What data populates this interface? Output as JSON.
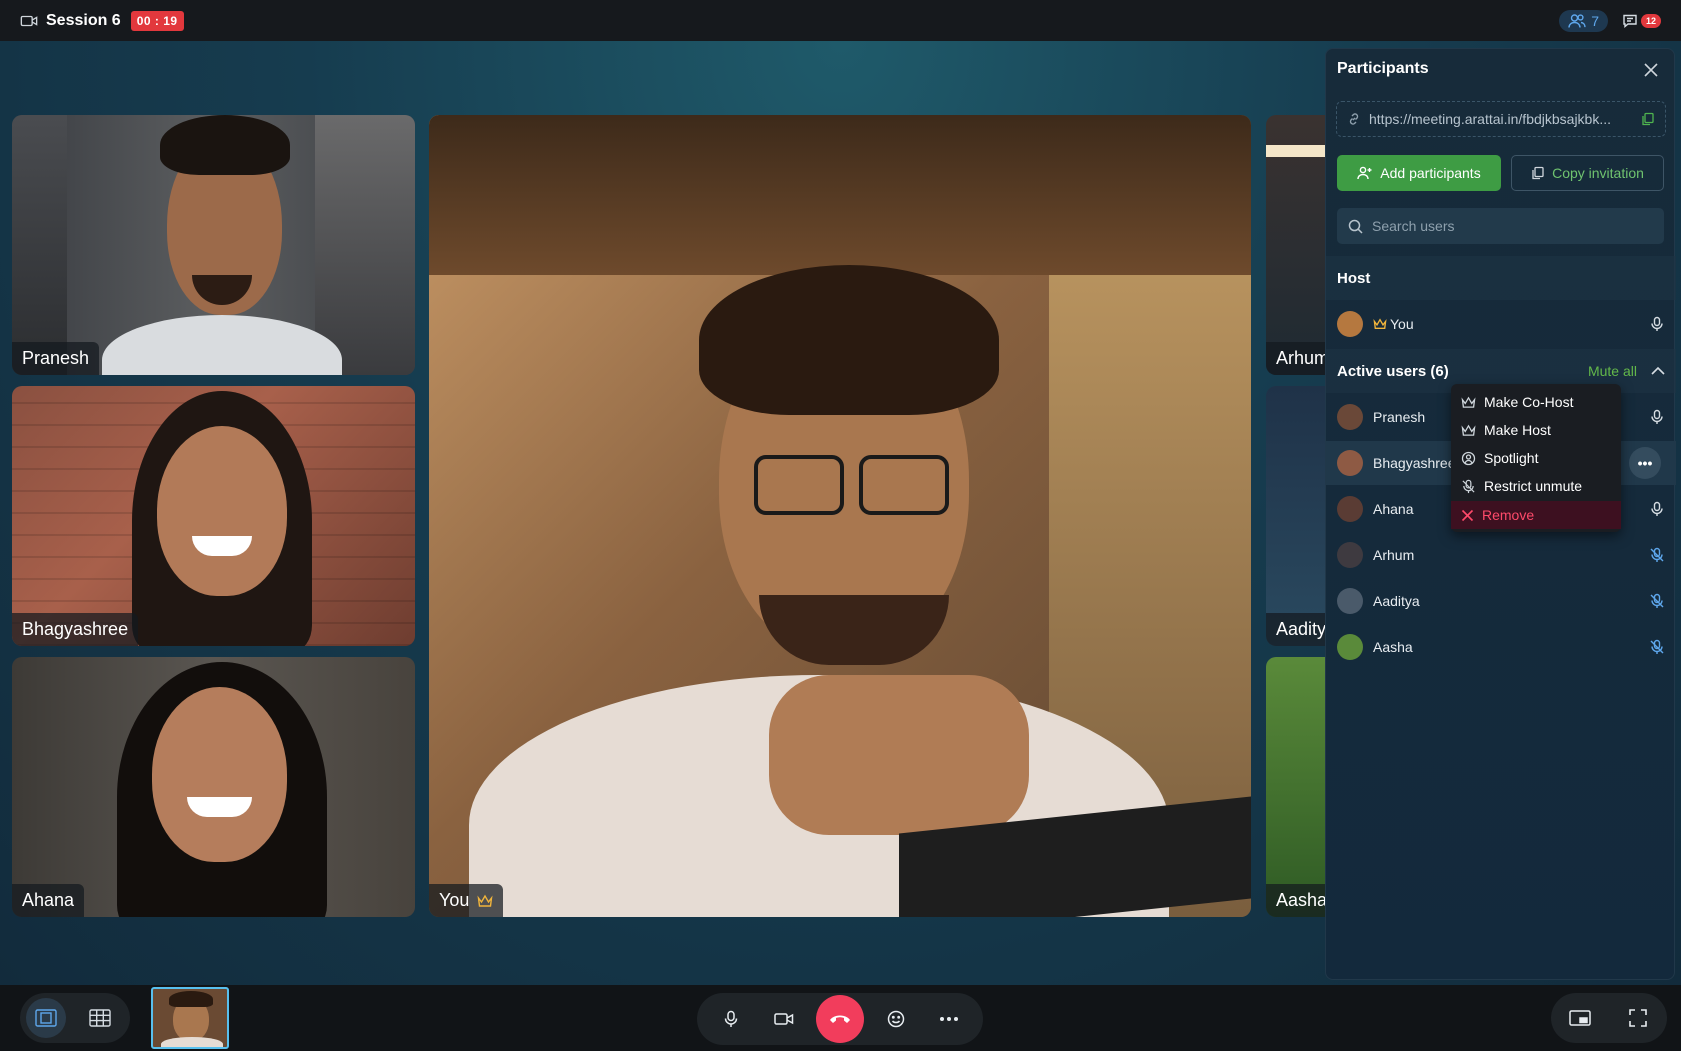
{
  "topbar": {
    "session_title": "Session 6",
    "timer": "00 : 19",
    "participant_count": "7",
    "chat_badge": "12"
  },
  "tiles": {
    "pranesh": "Pranesh",
    "bhagyashree": "Bhagyashree",
    "ahana": "Ahana",
    "you": "You",
    "arhum": "Arhum",
    "aaditya": "Aadity",
    "aasha": "Aasha"
  },
  "panel": {
    "title": "Participants",
    "invite_url": "https://meeting.arattai.in/fbdjkbsajkbk...",
    "add_button": "Add participants",
    "copy_button": "Copy invitation",
    "search_placeholder": "Search users",
    "host_section": "Host",
    "host_name": "You",
    "active_section": "Active users (6)",
    "mute_all": "Mute all",
    "users": [
      {
        "name": "Pranesh",
        "mic": "on"
      },
      {
        "name": "Bhagyashree",
        "mic": "menu"
      },
      {
        "name": "Ahana",
        "mic": "on"
      },
      {
        "name": "Arhum",
        "mic": "off"
      },
      {
        "name": "Aaditya",
        "mic": "off"
      },
      {
        "name": "Aasha",
        "mic": "off"
      }
    ]
  },
  "context_menu": {
    "items": [
      {
        "label": "Make Co-Host",
        "icon": "crown-icon"
      },
      {
        "label": "Make Host",
        "icon": "crown-icon"
      },
      {
        "label": "Spotlight",
        "icon": "spotlight-icon"
      },
      {
        "label": "Restrict unmute",
        "icon": "mic-off-icon"
      },
      {
        "label": "Remove",
        "icon": "close-icon"
      }
    ]
  },
  "colors": {
    "accent_green": "#3e9c44",
    "timer_red": "#e2383d",
    "end_call": "#f23d5c",
    "link_blue": "#5ea7ec"
  }
}
